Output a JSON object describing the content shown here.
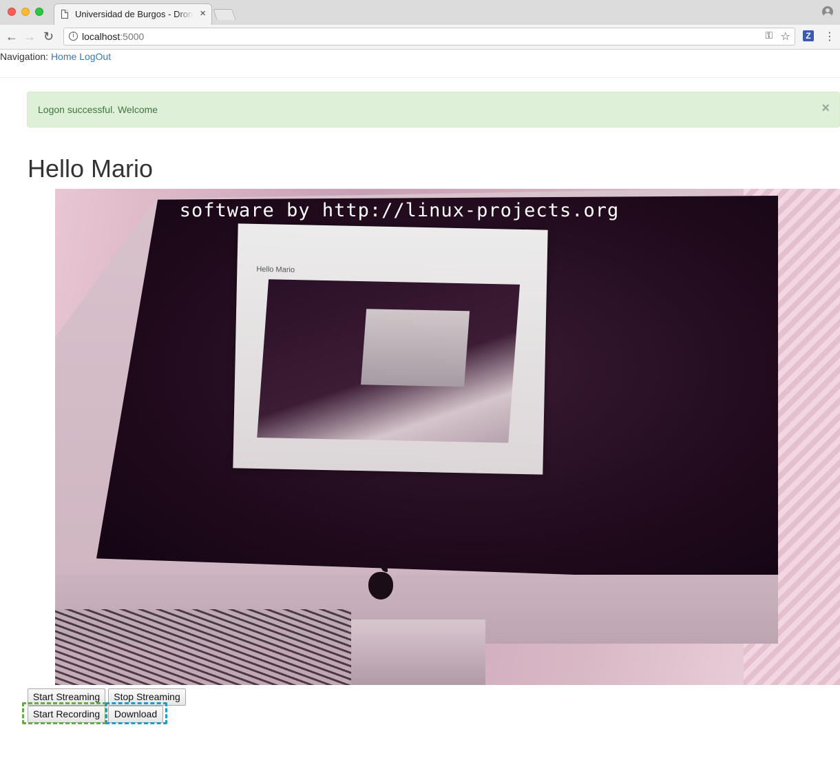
{
  "browser": {
    "tab_title": "Universidad de Burgos - Drone",
    "tab_close": "×",
    "url_host": "localhost",
    "url_port": ":5000",
    "extension_label": "Z"
  },
  "nav": {
    "label": "Navigation:",
    "home": "Home",
    "logout": "LogOut"
  },
  "alert": {
    "message": "Logon successful. Welcome",
    "close": "×"
  },
  "page": {
    "title": "Hello Mario"
  },
  "video": {
    "watermark": "software by http://linux-projects.org",
    "inner_title": "Hello Mario"
  },
  "controls": {
    "start_streaming": "Start Streaming",
    "stop_streaming": "Stop Streaming",
    "start_recording": "Start Recording",
    "download": "Download"
  },
  "colors": {
    "link": "#337ab7",
    "alert_bg": "#dff0d8",
    "alert_text": "#3c763d",
    "highlight_green": "#6aa84f",
    "highlight_blue": "#1f9bc4"
  }
}
